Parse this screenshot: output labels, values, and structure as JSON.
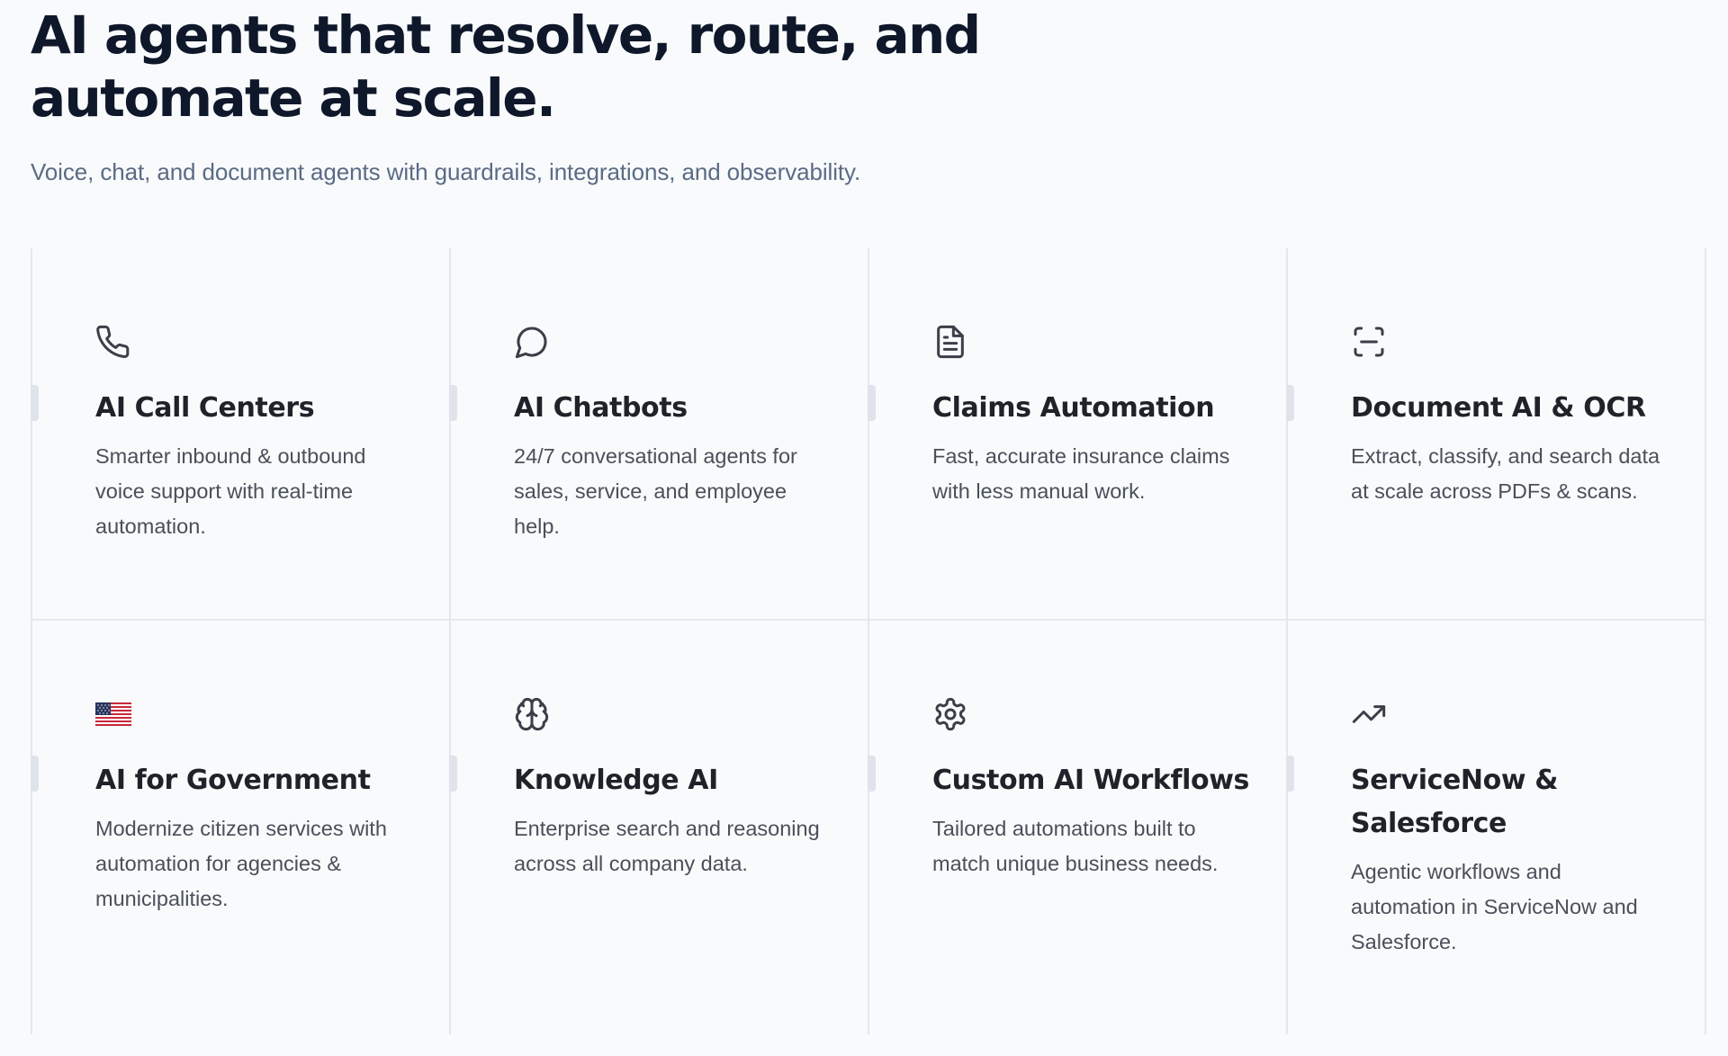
{
  "hero": {
    "title": "AI agents that resolve, route, and automate at scale.",
    "subtitle": "Voice, chat, and document agents with guardrails, integrations, and observability."
  },
  "cards": [
    {
      "icon": "phone-icon",
      "title": "AI Call Centers",
      "description": "Smarter inbound & outbound voice support with real-time automation."
    },
    {
      "icon": "chat-bubble-icon",
      "title": "AI Chatbots",
      "description": "24/7 conversational agents for sales, service, and employee help."
    },
    {
      "icon": "document-icon",
      "title": "Claims Automation",
      "description": "Fast, accurate insurance claims with less manual work."
    },
    {
      "icon": "scan-icon",
      "title": "Document AI & OCR",
      "description": "Extract, classify, and search data at scale across PDFs & scans."
    },
    {
      "icon": "us-flag-icon",
      "title": "AI for Government",
      "description": "Modernize citizen services with automation for agencies & municipalities."
    },
    {
      "icon": "brain-icon",
      "title": "Knowledge AI",
      "description": "Enterprise search and reasoning across all company data."
    },
    {
      "icon": "gear-icon",
      "title": "Custom AI Workflows",
      "description": "Tailored automations built to match unique business needs."
    },
    {
      "icon": "trending-up-icon",
      "title": "ServiceNow & Salesforce",
      "description": "Agentic workflows and automation in ServiceNow and Salesforce."
    }
  ],
  "colors": {
    "background": "#f8fafc",
    "heading": "#0f172a",
    "subtitle": "#5a6b84",
    "card_title": "#1f2329",
    "card_text": "#4a5059",
    "divider": "#e4e8ee",
    "flag_red": "#c8283a",
    "flag_blue": "#27345f"
  }
}
